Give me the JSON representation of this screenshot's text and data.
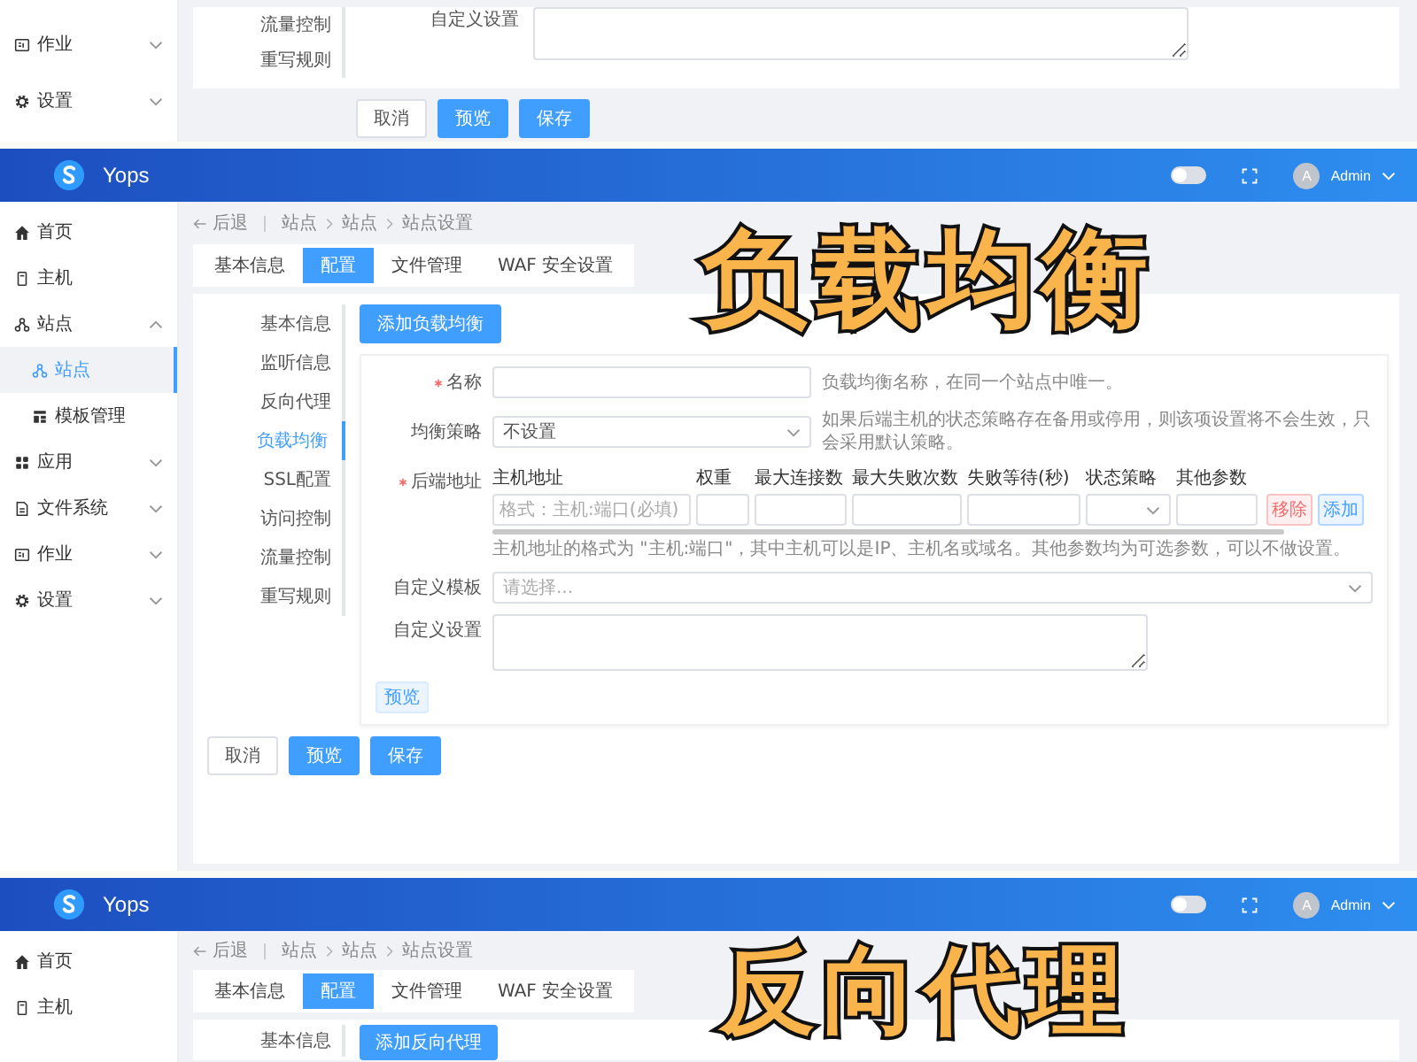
{
  "top_fragment": {
    "sidebar": [
      {
        "label": "作业",
        "kind": "group",
        "expanded": false,
        "selected": false
      },
      {
        "label": "设置",
        "kind": "group",
        "expanded": false,
        "selected": false
      }
    ],
    "config_menu": [
      {
        "label": "流量控制",
        "selected": false
      },
      {
        "label": "重写规则",
        "selected": false
      }
    ],
    "custom_settings_label": "自定义设置",
    "buttons": [
      {
        "label": "取消",
        "kind": "default"
      },
      {
        "label": "预览",
        "kind": "primary"
      },
      {
        "label": "保存",
        "kind": "primary"
      }
    ]
  },
  "middle_screen": {
    "header": {
      "app_name": "Yops",
      "theme_switch": {
        "on": false
      },
      "avatar_letter": "A",
      "user": "Admin"
    },
    "sidebar": [
      {
        "label": "首页",
        "kind": "link",
        "selected": false
      },
      {
        "label": "主机",
        "kind": "link",
        "selected": false
      },
      {
        "label": "站点",
        "kind": "group",
        "expanded": true,
        "selected": false,
        "children": [
          {
            "label": "站点",
            "selected": true
          },
          {
            "label": "模板管理",
            "selected": false
          }
        ]
      },
      {
        "label": "应用",
        "kind": "group",
        "expanded": false,
        "selected": false
      },
      {
        "label": "文件系统",
        "kind": "group",
        "expanded": false,
        "selected": false
      },
      {
        "label": "作业",
        "kind": "group",
        "expanded": false,
        "selected": false
      },
      {
        "label": "设置",
        "kind": "group",
        "expanded": false,
        "selected": false
      }
    ],
    "breadcrumb": {
      "back": "后退",
      "items": [
        "站点",
        "站点",
        "站点设置"
      ]
    },
    "tabs": [
      {
        "label": "基本信息",
        "selected": false
      },
      {
        "label": "配置",
        "selected": true
      },
      {
        "label": "文件管理",
        "selected": false
      },
      {
        "label": "WAF 安全设置",
        "selected": false
      }
    ],
    "config_menu": [
      {
        "label": "基本信息",
        "selected": false
      },
      {
        "label": "监听信息",
        "selected": false
      },
      {
        "label": "反向代理",
        "selected": false
      },
      {
        "label": "负载均衡",
        "selected": true
      },
      {
        "label": "SSL配置",
        "selected": false
      },
      {
        "label": "访问控制",
        "selected": false
      },
      {
        "label": "流量控制",
        "selected": false
      },
      {
        "label": "重写规则",
        "selected": false
      }
    ],
    "add_button": "添加负载均衡",
    "form": {
      "name": {
        "label": "名称",
        "required": true,
        "help": "负载均衡名称，在同一个站点中唯一。"
      },
      "strategy": {
        "label": "均衡策略",
        "required": false,
        "value": "不设置",
        "help": "如果后端主机的状态策略存在备用或停用，则该项设置将不会生效，只会采用默认策略。"
      },
      "backends": {
        "label": "后端地址",
        "required": true,
        "columns": [
          {
            "label": "主机地址",
            "kind": "input"
          },
          {
            "label": "权重",
            "kind": "input"
          },
          {
            "label": "最大连接数",
            "kind": "input"
          },
          {
            "label": "最大失败次数",
            "kind": "input"
          },
          {
            "label": "失败等待(秒)",
            "kind": "input"
          },
          {
            "label": "状态策略",
            "kind": "select"
          },
          {
            "label": "其他参数",
            "kind": "input"
          }
        ],
        "rows": [
          {
            "host": {
              "placeholder": "格式：主机:端口(必填)"
            }
          }
        ],
        "remove_button": "移除",
        "add_button": "添加",
        "help": "主机地址的格式为 \"主机:端口\"，其中主机可以是IP、主机名或域名。其他参数均为可选参数，可以不做设置。"
      },
      "template": {
        "label": "自定义模板",
        "required": false,
        "placeholder": "请选择..."
      },
      "custom_settings": {
        "label": "自定义设置",
        "required": false
      },
      "preview_button": "预览"
    },
    "buttons": [
      {
        "label": "取消",
        "kind": "default"
      },
      {
        "label": "预览",
        "kind": "primary"
      },
      {
        "label": "保存",
        "kind": "primary"
      }
    ],
    "caption": "负载均衡"
  },
  "bottom_screen": {
    "header": {
      "app_name": "Yops",
      "theme_switch": {
        "on": false
      },
      "avatar_letter": "A",
      "user": "Admin"
    },
    "sidebar": [
      {
        "label": "首页",
        "kind": "link",
        "selected": false
      },
      {
        "label": "主机",
        "kind": "link",
        "selected": false
      }
    ],
    "breadcrumb": {
      "back": "后退",
      "items": [
        "站点",
        "站点",
        "站点设置"
      ]
    },
    "tabs": [
      {
        "label": "基本信息",
        "selected": false
      },
      {
        "label": "配置",
        "selected": true
      },
      {
        "label": "文件管理",
        "selected": false
      },
      {
        "label": "WAF 安全设置",
        "selected": false
      }
    ],
    "config_menu": [
      {
        "label": "基本信息",
        "selected": false
      }
    ],
    "add_button": "添加反向代理",
    "caption": "反向代理"
  }
}
